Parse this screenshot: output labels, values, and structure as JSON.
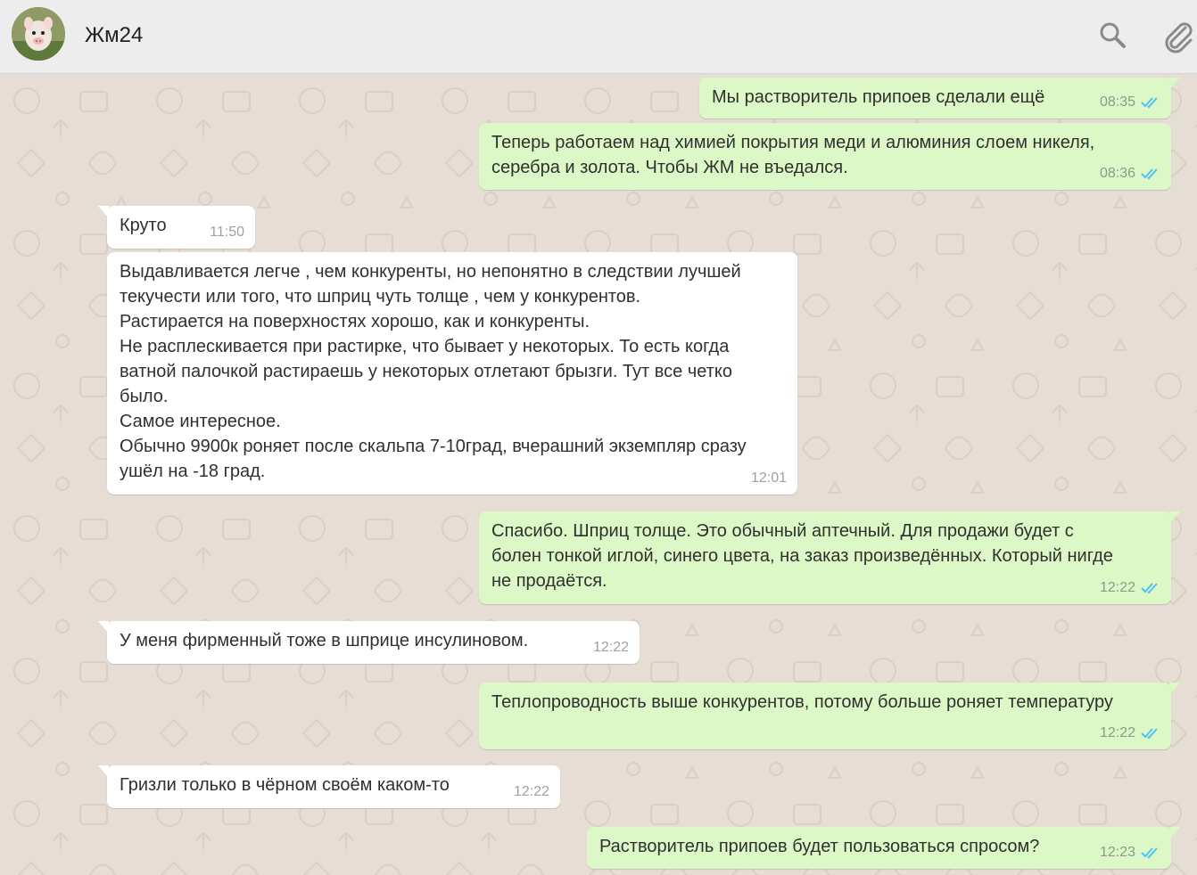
{
  "header": {
    "title": "Жм24",
    "avatar_icon": "piglet-avatar-icon",
    "search_icon": "search-icon",
    "attach_icon": "paperclip-icon"
  },
  "colors": {
    "outgoing_bubble": "#dcf8c6",
    "incoming_bubble": "#ffffff",
    "read_ticks": "#4fc3f7",
    "wallpaper": "#e6ddd4"
  },
  "messages": [
    {
      "direction": "out",
      "text": "Мы растворитель припоев сделали ещё",
      "time": "08:35",
      "status": "read"
    },
    {
      "direction": "out",
      "text": "Теперь работаем над химией покрытия меди и алюминия слоем никеля,\nсеребра и золота. Чтобы ЖМ не въедался.",
      "time": "08:36",
      "status": "read"
    },
    {
      "direction": "in",
      "text": "Круто",
      "time": "11:50"
    },
    {
      "direction": "in",
      "text": "Выдавливается легче , чем конкуренты, но непонятно в следствии лучшей\nтекучести или того, что шприц чуть толще , чем у конкурентов.\nРастирается на поверхностях хорошо, как и конкуренты.\nНе расплескивается при растирке, что бывает у некоторых. То есть когда\nватной палочкой растираешь у некоторых отлетают брызги. Тут все четко\nбыло.\nСамое интересное.\nОбычно 9900к роняет после скальпа 7-10град, вчерашний экземпляр сразу\nушёл на -18 град.",
      "time": "12:01"
    },
    {
      "direction": "out",
      "text": "Спасибо. Шприц толще. Это обычный аптечный. Для продажи будет с\nболен тонкой иглой, синего цвета, на заказ произведённых. Который нигде\nне продаётся.",
      "time": "12:22",
      "status": "read"
    },
    {
      "direction": "in",
      "text": "У меня фирменный тоже в шприце инсулиновом.",
      "time": "12:22"
    },
    {
      "direction": "out",
      "text": "Теплопроводность выше конкурентов, потому больше роняет температуру",
      "time": "12:22",
      "status": "read"
    },
    {
      "direction": "in",
      "text": "Гризли только в чёрном своём каком-то",
      "time": "12:22"
    },
    {
      "direction": "out",
      "text": "Растворитель припоев будет пользоваться спросом?",
      "time": "12:23",
      "status": "read"
    }
  ]
}
